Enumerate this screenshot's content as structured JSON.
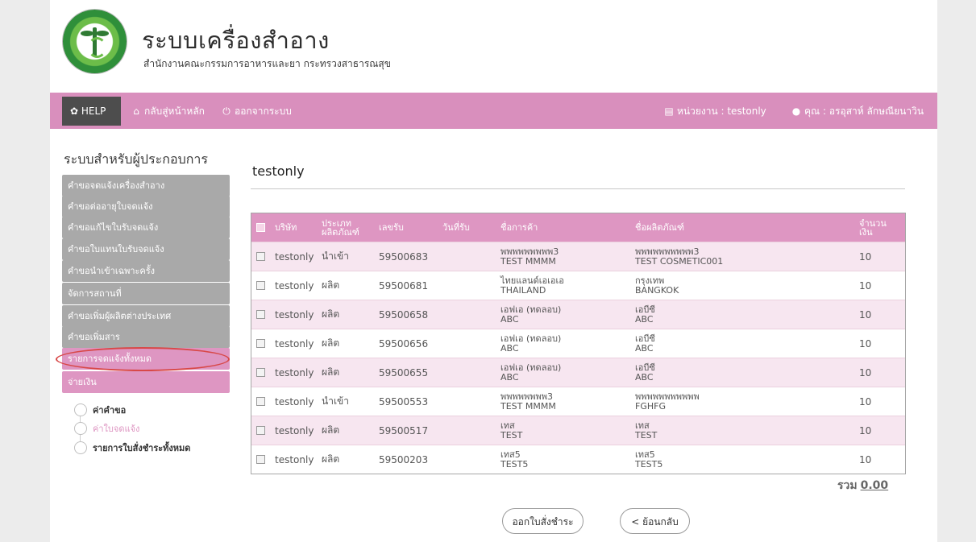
{
  "header": {
    "title": "ระบบเครื่องสำอาง",
    "subtitle": "สำนักงานคณะกรรมการอาหารและยา กระทรวงสาธารณสุข"
  },
  "navbar": {
    "help": "HELP",
    "home": "กลับสู่หน้าหลัก",
    "logout": "ออกจากระบบ",
    "unit": "หน่วยงาน : testonly",
    "user": "คุณ : อรอุสาห์ ลักษณียนาวิน",
    "colors": {
      "bar": "#de96c2",
      "help_bg": "#4d4d4d"
    }
  },
  "sidebar": {
    "title": "ระบบสำหรับผู้ประกอบการ",
    "items": [
      {
        "label": "คำขอจดแจ้งเครื่องสำอาง"
      },
      {
        "label": "คำขอต่ออายุใบจดแจ้ง"
      },
      {
        "label": "คำขอแก้ไขใบรับจดแจ้ง"
      },
      {
        "label": "คำขอใบแทนใบรับจดแจ้ง"
      },
      {
        "label": "คำขอนำเข้าเฉพาะครั้ง"
      },
      {
        "label": "จัดการสถานที่"
      },
      {
        "label": "คำขอเพิ่มผู้ผลิตต่างประเทศ"
      },
      {
        "label": "คำขอเพิ่มสาร"
      },
      {
        "label": "รายการจดแจ้งทั้งหมด"
      },
      {
        "label": "จ่ายเงิน"
      }
    ],
    "radios": [
      {
        "label": "ค่าคำขอ"
      },
      {
        "label": "ค่าใบจดแจ้ง"
      },
      {
        "label": "รายการใบสั่งชำระทั้งหมด"
      }
    ]
  },
  "main": {
    "org": "testonly",
    "table": {
      "headers": {
        "company": "บริษัท",
        "type": "ประเภทผลิตภัณฑ์",
        "receipt": "เลขรับ",
        "date": "วันที่รับ",
        "trade": "ชื่อการค้า",
        "product": "ชื่อผลิตภัณฑ์",
        "amount": "จำนวนเงิน"
      },
      "rows": [
        {
          "company": "testonly",
          "type": "นำเข้า",
          "receipt": "59500683",
          "date": "",
          "trade1": "พพพพพพพพพ3",
          "trade2": "TEST MMMM",
          "product1": "พพพพพพพพพพ3",
          "product2": "TEST COSMETIC001",
          "amount": "10"
        },
        {
          "company": "testonly",
          "type": "ผลิต",
          "receipt": "59500681",
          "date": "",
          "trade1": "ไทยแลนด์เอเอเอ",
          "trade2": "THAILAND",
          "product1": "กรุงเทพ",
          "product2": "BANGKOK",
          "amount": "10"
        },
        {
          "company": "testonly",
          "type": "ผลิต",
          "receipt": "59500658",
          "date": "",
          "trade1": "เอฟเอ (ทดลอบ)",
          "trade2": "ABC",
          "product1": "เอบีซี",
          "product2": "ABC",
          "amount": "10"
        },
        {
          "company": "testonly",
          "type": "ผลิต",
          "receipt": "59500656",
          "date": "",
          "trade1": "เอฟเอ (ทดลอบ)",
          "trade2": "ABC",
          "product1": "เอบีซี",
          "product2": "ABC",
          "amount": "10"
        },
        {
          "company": "testonly",
          "type": "ผลิต",
          "receipt": "59500655",
          "date": "",
          "trade1": "เอฟเอ (ทดลอบ)",
          "trade2": "ABC",
          "product1": "เอบีซี",
          "product2": "ABC",
          "amount": "10"
        },
        {
          "company": "testonly",
          "type": "นำเข้า",
          "receipt": "59500553",
          "date": "",
          "trade1": "พพพพพพพพ3",
          "trade2": "TEST MMMM",
          "product1": "พพพพพพพพพพพ",
          "product2": "FGHFG",
          "amount": "10"
        },
        {
          "company": "testonly",
          "type": "ผลิต",
          "receipt": "59500517",
          "date": "",
          "trade1": "เทส",
          "trade2": "TEST",
          "product1": "เทส",
          "product2": "TEST",
          "amount": "10"
        },
        {
          "company": "testonly",
          "type": "ผลิต",
          "receipt": "59500203",
          "date": "",
          "trade1": "เทส5",
          "trade2": "TEST5",
          "product1": "เทส5",
          "product2": "TEST5",
          "amount": "10"
        }
      ]
    },
    "total_label": "รวม",
    "total_value": "0.00",
    "buttons": {
      "pay": "ออกใบสั่งชำระ",
      "back": "< ย้อนกลับ"
    }
  }
}
